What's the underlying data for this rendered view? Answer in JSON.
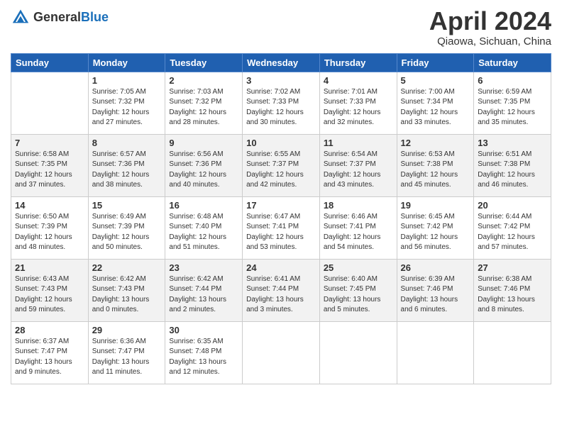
{
  "header": {
    "logo_general": "General",
    "logo_blue": "Blue",
    "month_title": "April 2024",
    "location": "Qiaowa, Sichuan, China"
  },
  "weekdays": [
    "Sunday",
    "Monday",
    "Tuesday",
    "Wednesday",
    "Thursday",
    "Friday",
    "Saturday"
  ],
  "weeks": [
    {
      "alt": false,
      "days": [
        {
          "num": "",
          "info": ""
        },
        {
          "num": "1",
          "info": "Sunrise: 7:05 AM\nSunset: 7:32 PM\nDaylight: 12 hours\nand 27 minutes."
        },
        {
          "num": "2",
          "info": "Sunrise: 7:03 AM\nSunset: 7:32 PM\nDaylight: 12 hours\nand 28 minutes."
        },
        {
          "num": "3",
          "info": "Sunrise: 7:02 AM\nSunset: 7:33 PM\nDaylight: 12 hours\nand 30 minutes."
        },
        {
          "num": "4",
          "info": "Sunrise: 7:01 AM\nSunset: 7:33 PM\nDaylight: 12 hours\nand 32 minutes."
        },
        {
          "num": "5",
          "info": "Sunrise: 7:00 AM\nSunset: 7:34 PM\nDaylight: 12 hours\nand 33 minutes."
        },
        {
          "num": "6",
          "info": "Sunrise: 6:59 AM\nSunset: 7:35 PM\nDaylight: 12 hours\nand 35 minutes."
        }
      ]
    },
    {
      "alt": true,
      "days": [
        {
          "num": "7",
          "info": "Sunrise: 6:58 AM\nSunset: 7:35 PM\nDaylight: 12 hours\nand 37 minutes."
        },
        {
          "num": "8",
          "info": "Sunrise: 6:57 AM\nSunset: 7:36 PM\nDaylight: 12 hours\nand 38 minutes."
        },
        {
          "num": "9",
          "info": "Sunrise: 6:56 AM\nSunset: 7:36 PM\nDaylight: 12 hours\nand 40 minutes."
        },
        {
          "num": "10",
          "info": "Sunrise: 6:55 AM\nSunset: 7:37 PM\nDaylight: 12 hours\nand 42 minutes."
        },
        {
          "num": "11",
          "info": "Sunrise: 6:54 AM\nSunset: 7:37 PM\nDaylight: 12 hours\nand 43 minutes."
        },
        {
          "num": "12",
          "info": "Sunrise: 6:53 AM\nSunset: 7:38 PM\nDaylight: 12 hours\nand 45 minutes."
        },
        {
          "num": "13",
          "info": "Sunrise: 6:51 AM\nSunset: 7:38 PM\nDaylight: 12 hours\nand 46 minutes."
        }
      ]
    },
    {
      "alt": false,
      "days": [
        {
          "num": "14",
          "info": "Sunrise: 6:50 AM\nSunset: 7:39 PM\nDaylight: 12 hours\nand 48 minutes."
        },
        {
          "num": "15",
          "info": "Sunrise: 6:49 AM\nSunset: 7:39 PM\nDaylight: 12 hours\nand 50 minutes."
        },
        {
          "num": "16",
          "info": "Sunrise: 6:48 AM\nSunset: 7:40 PM\nDaylight: 12 hours\nand 51 minutes."
        },
        {
          "num": "17",
          "info": "Sunrise: 6:47 AM\nSunset: 7:41 PM\nDaylight: 12 hours\nand 53 minutes."
        },
        {
          "num": "18",
          "info": "Sunrise: 6:46 AM\nSunset: 7:41 PM\nDaylight: 12 hours\nand 54 minutes."
        },
        {
          "num": "19",
          "info": "Sunrise: 6:45 AM\nSunset: 7:42 PM\nDaylight: 12 hours\nand 56 minutes."
        },
        {
          "num": "20",
          "info": "Sunrise: 6:44 AM\nSunset: 7:42 PM\nDaylight: 12 hours\nand 57 minutes."
        }
      ]
    },
    {
      "alt": true,
      "days": [
        {
          "num": "21",
          "info": "Sunrise: 6:43 AM\nSunset: 7:43 PM\nDaylight: 12 hours\nand 59 minutes."
        },
        {
          "num": "22",
          "info": "Sunrise: 6:42 AM\nSunset: 7:43 PM\nDaylight: 13 hours\nand 0 minutes."
        },
        {
          "num": "23",
          "info": "Sunrise: 6:42 AM\nSunset: 7:44 PM\nDaylight: 13 hours\nand 2 minutes."
        },
        {
          "num": "24",
          "info": "Sunrise: 6:41 AM\nSunset: 7:44 PM\nDaylight: 13 hours\nand 3 minutes."
        },
        {
          "num": "25",
          "info": "Sunrise: 6:40 AM\nSunset: 7:45 PM\nDaylight: 13 hours\nand 5 minutes."
        },
        {
          "num": "26",
          "info": "Sunrise: 6:39 AM\nSunset: 7:46 PM\nDaylight: 13 hours\nand 6 minutes."
        },
        {
          "num": "27",
          "info": "Sunrise: 6:38 AM\nSunset: 7:46 PM\nDaylight: 13 hours\nand 8 minutes."
        }
      ]
    },
    {
      "alt": false,
      "days": [
        {
          "num": "28",
          "info": "Sunrise: 6:37 AM\nSunset: 7:47 PM\nDaylight: 13 hours\nand 9 minutes."
        },
        {
          "num": "29",
          "info": "Sunrise: 6:36 AM\nSunset: 7:47 PM\nDaylight: 13 hours\nand 11 minutes."
        },
        {
          "num": "30",
          "info": "Sunrise: 6:35 AM\nSunset: 7:48 PM\nDaylight: 13 hours\nand 12 minutes."
        },
        {
          "num": "",
          "info": ""
        },
        {
          "num": "",
          "info": ""
        },
        {
          "num": "",
          "info": ""
        },
        {
          "num": "",
          "info": ""
        }
      ]
    }
  ]
}
